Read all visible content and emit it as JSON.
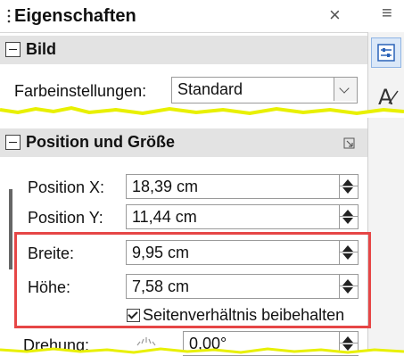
{
  "panel": {
    "title": "Eigenschaften",
    "close_glyph": "×",
    "menu_glyph": "≡"
  },
  "sections": {
    "bild": {
      "title": "Bild",
      "farbeinstellungen_label": "Farbeinstellungen:",
      "farbeinstellungen_value": "Standard"
    },
    "position": {
      "title": "Position und Größe",
      "pos_x_label": "Position X:",
      "pos_x_value": "18,39 cm",
      "pos_y_label": "Position Y:",
      "pos_y_value": "11,44 cm",
      "breite_label": "Breite:",
      "breite_value": "9,95 cm",
      "hoehe_label": "Höhe:",
      "hoehe_value": "7,58 cm",
      "aspect_label": "Seitenverhältnis beibehalten",
      "aspect_checked": true,
      "drehung_label": "Drehung:",
      "drehung_value": "0,00°"
    }
  },
  "icons": {
    "grip": "grip-icon",
    "properties_deck": "properties-deck-icon",
    "styles_deck": "styles-deck-icon",
    "more_options": "more-options-icon"
  },
  "colors": {
    "highlight": "#e64646",
    "tear": "#e8f000"
  }
}
